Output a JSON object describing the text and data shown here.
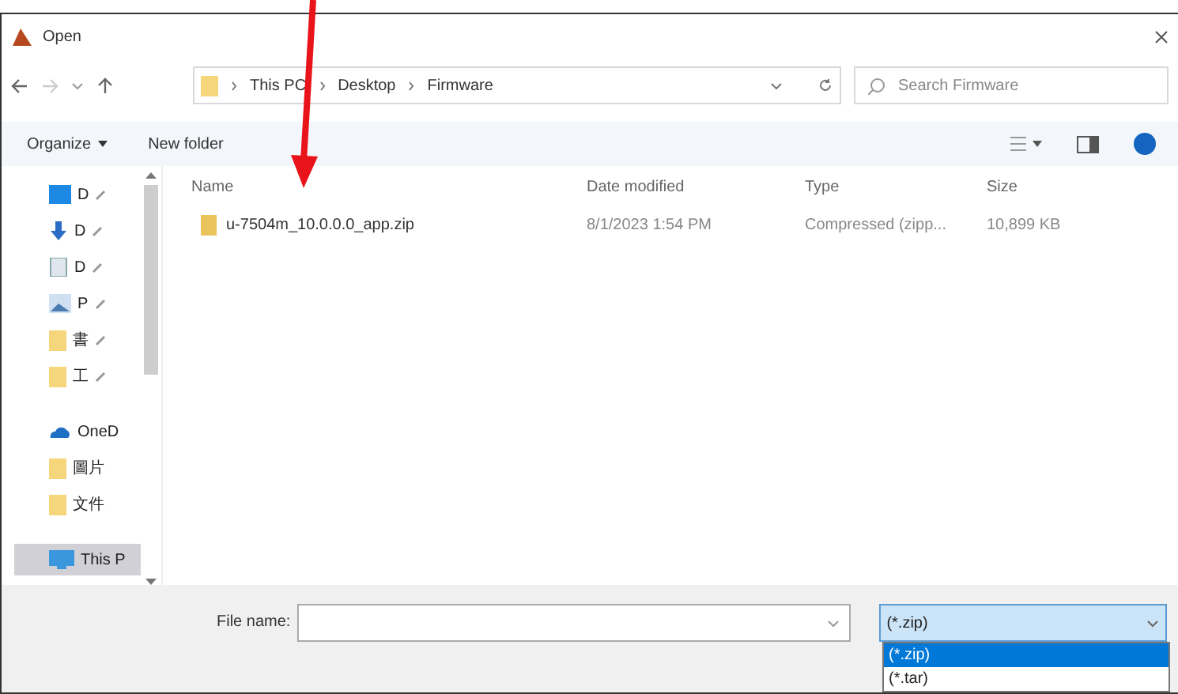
{
  "window": {
    "title": "Open"
  },
  "address": {
    "crumbs": [
      "This PC",
      "Desktop",
      "Firmware"
    ],
    "search_placeholder": "Search Firmware"
  },
  "toolbar": {
    "organize": "Organize",
    "new_folder": "New folder"
  },
  "sidebar": {
    "items": [
      {
        "kind": "desktop",
        "label": "D",
        "pinned": true,
        "selected": false
      },
      {
        "kind": "download",
        "label": "D",
        "pinned": true,
        "selected": false
      },
      {
        "kind": "document",
        "label": "D",
        "pinned": true,
        "selected": false
      },
      {
        "kind": "picture",
        "label": "P",
        "pinned": true,
        "selected": false
      },
      {
        "kind": "folder",
        "label": "書",
        "pinned": true,
        "selected": false
      },
      {
        "kind": "folder",
        "label": "工",
        "pinned": true,
        "selected": false
      },
      {
        "kind": "cloud",
        "label": "OneD",
        "pinned": false,
        "selected": false
      },
      {
        "kind": "folder",
        "label": "圖片",
        "pinned": false,
        "selected": false
      },
      {
        "kind": "folder",
        "label": "文件",
        "pinned": false,
        "selected": false
      },
      {
        "kind": "pc",
        "label": "This P",
        "pinned": false,
        "selected": true
      }
    ]
  },
  "table": {
    "columns": [
      "Name",
      "Date modified",
      "Type",
      "Size"
    ],
    "rows": [
      {
        "name": "u-7504m_10.0.0.0_app.zip",
        "date": "8/1/2023 1:54 PM",
        "type": "Compressed (zipp...",
        "size": "10,899 KB"
      }
    ]
  },
  "footer": {
    "file_name_label": "File name:",
    "filter": "(*.zip)",
    "filter_options": [
      {
        "label": "(*.zip)",
        "selected": true
      },
      {
        "label": "(*.tar)",
        "selected": false
      }
    ]
  }
}
